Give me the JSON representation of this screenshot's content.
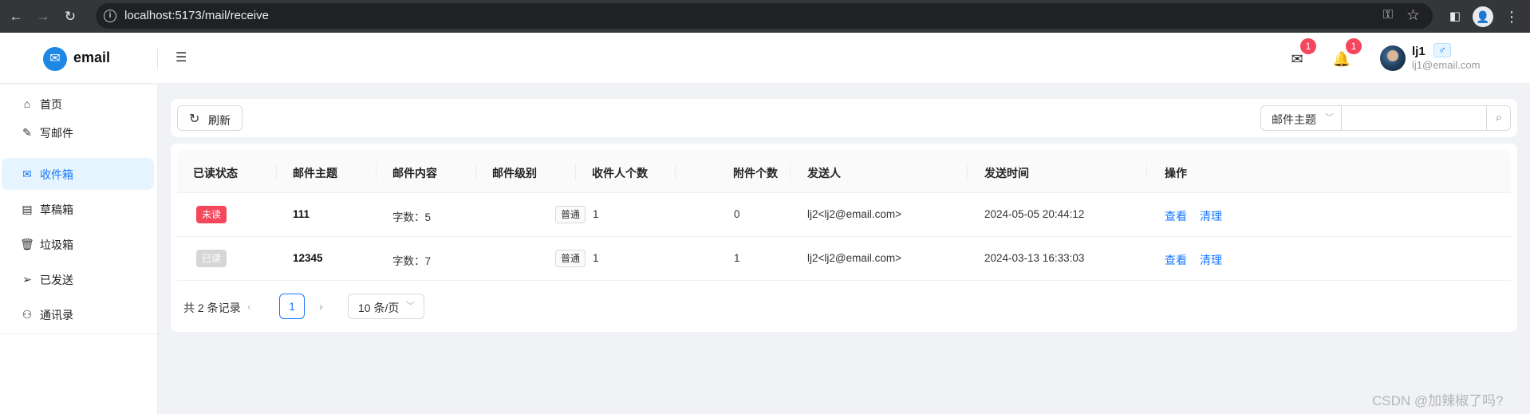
{
  "browser": {
    "url": "localhost:5173/mail/receive"
  },
  "header": {
    "logo_text": "email",
    "mail_badge": "1",
    "bell_badge": "1",
    "username": "lj1",
    "gender": "♂",
    "email": "lj1@email.com"
  },
  "sidebar": {
    "items": [
      {
        "label": "首页",
        "icon": "home-icon",
        "glyph": "⌂"
      },
      {
        "label": "写邮件",
        "icon": "edit-icon",
        "glyph": "✎"
      },
      {
        "label": "收件箱",
        "icon": "mail-icon",
        "glyph": "✉"
      },
      {
        "label": "草稿箱",
        "icon": "draft-icon",
        "glyph": "▤"
      },
      {
        "label": "垃圾箱",
        "icon": "trash-icon",
        "glyph": "🗑"
      },
      {
        "label": "已发送",
        "icon": "send-icon",
        "glyph": "➢"
      },
      {
        "label": "通讯录",
        "icon": "contacts-icon",
        "glyph": "⚇"
      }
    ],
    "active_index": 2
  },
  "toolbar": {
    "refresh_label": "刷新",
    "search_field": "邮件主题",
    "search_value": ""
  },
  "table": {
    "columns": [
      "已读状态",
      "邮件主题",
      "邮件内容",
      "邮件级别",
      "收件人个数",
      "附件个数",
      "发送人",
      "发送时间",
      "操作"
    ],
    "rows": [
      {
        "status": "未读",
        "status_color": "#f5475b",
        "subject": "111",
        "content": "字数：5",
        "level": "普通",
        "recipients": "1",
        "attachments": "0",
        "sender": "lj2<lj2@email.com>",
        "time": "2024-05-05 20:44:12",
        "view": "查看",
        "clean": "清理"
      },
      {
        "status": "已读",
        "status_color": "#d6d6d6",
        "subject": "12345",
        "content": "字数：7",
        "level": "普通",
        "recipients": "1",
        "attachments": "1",
        "sender": "lj2<lj2@email.com>",
        "time": "2024-03-13 16:33:03",
        "view": "查看",
        "clean": "清理"
      }
    ]
  },
  "pagination": {
    "total": "共 2 条记录",
    "current_page": "1",
    "page_size": "10 条/页"
  },
  "watermark": "CSDN @加辣椒了吗?"
}
